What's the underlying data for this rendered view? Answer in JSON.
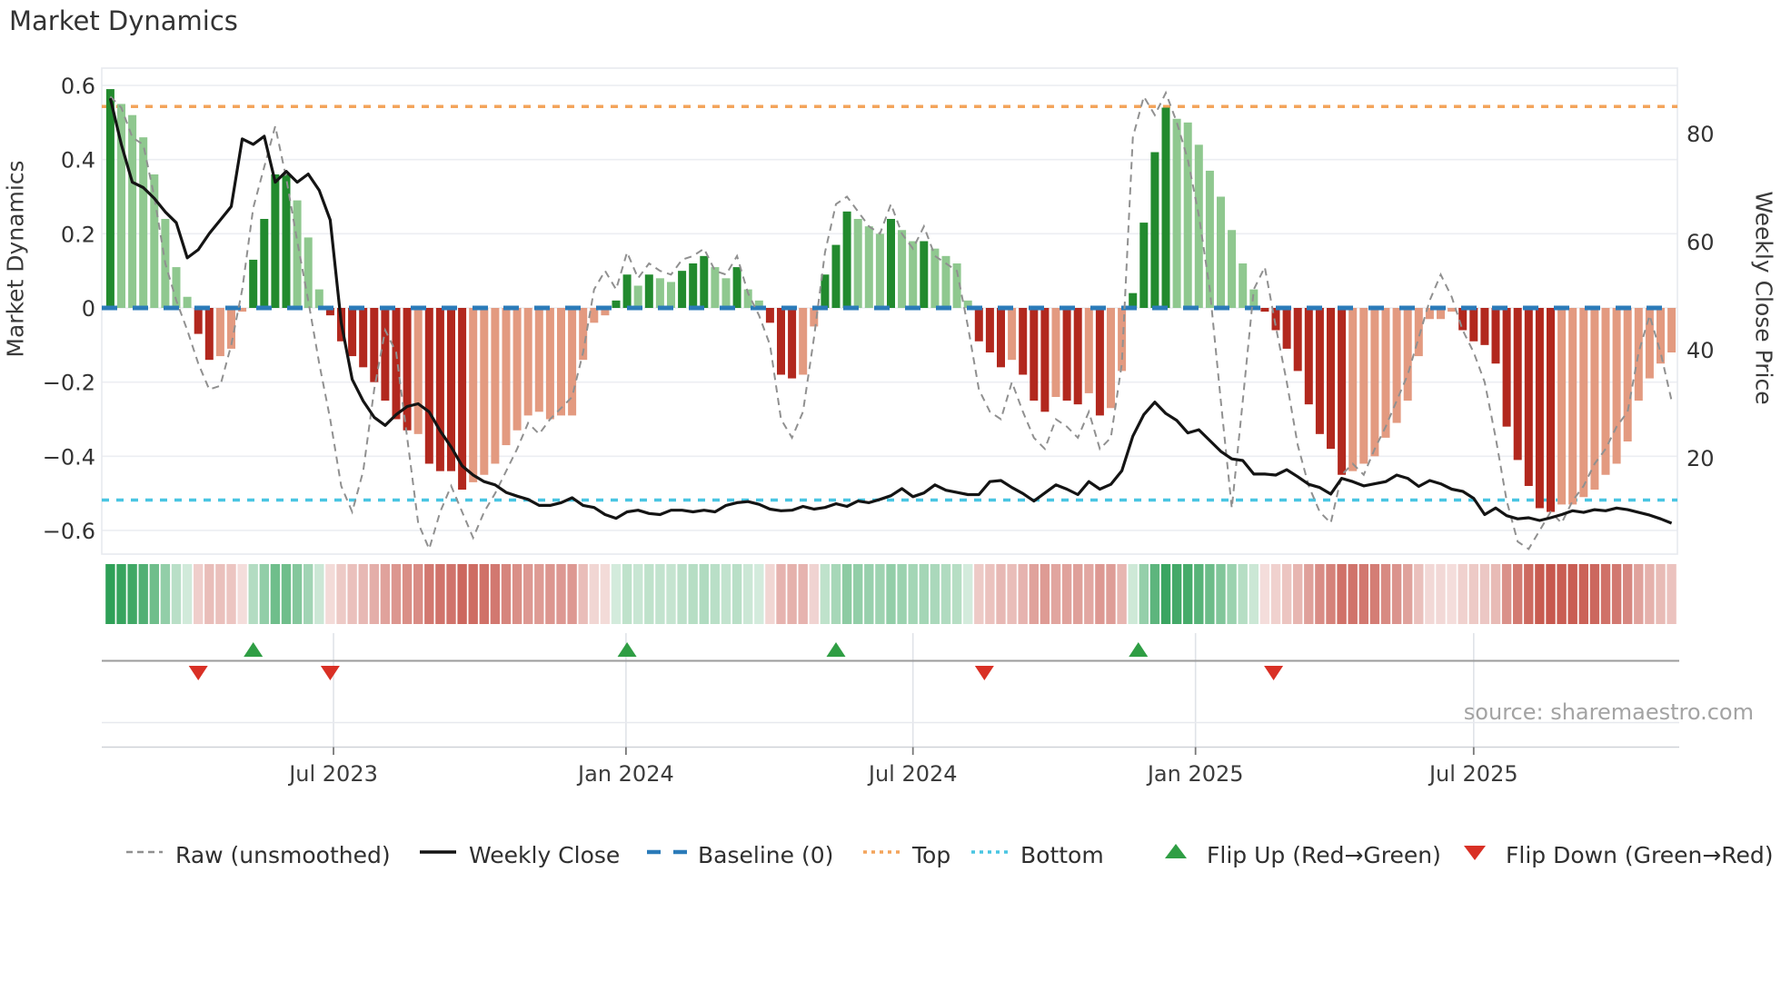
{
  "title": "Market Dynamics",
  "source": "source: sharemaestro.com",
  "axes": {
    "left_label": "Market Dynamics",
    "right_label": "Weekly Close Price",
    "left_ticks": [
      "0.6",
      "0.4",
      "0.2",
      "0",
      "−0.2",
      "−0.4",
      "−0.6"
    ],
    "left_tick_values": [
      0.6,
      0.4,
      0.2,
      0,
      -0.2,
      -0.4,
      -0.6
    ],
    "right_ticks": [
      "80",
      "60",
      "40",
      "20"
    ],
    "right_tick_values": [
      80,
      60,
      40,
      20
    ],
    "x_ticks": [
      {
        "label": "Jul 2023",
        "week": 20.3
      },
      {
        "label": "Jan 2024",
        "week": 46.9
      },
      {
        "label": "Jul 2024",
        "week": 73.0
      },
      {
        "label": "Jan 2025",
        "week": 98.7
      },
      {
        "label": "Jul 2025",
        "week": 124.0
      }
    ]
  },
  "chart_data": {
    "type": "bar",
    "title": "Market Dynamics",
    "x_unit": "weekly",
    "n_points": 143,
    "ylim_left": [
      -0.66,
      0.65
    ],
    "baseline": 0,
    "top_threshold": 0.543,
    "bottom_threshold": -0.518,
    "grid": "horizontal",
    "series": [
      {
        "name": "Market Dynamics (bars)",
        "type": "bar",
        "axis": "left",
        "values": [
          0.59,
          0.55,
          0.52,
          0.46,
          0.36,
          0.24,
          0.11,
          0.03,
          -0.07,
          -0.14,
          -0.13,
          -0.11,
          -0.01,
          0.13,
          0.24,
          0.36,
          0.36,
          0.29,
          0.19,
          0.05,
          -0.02,
          -0.09,
          -0.13,
          -0.16,
          -0.2,
          -0.25,
          -0.3,
          -0.33,
          -0.34,
          -0.42,
          -0.44,
          -0.44,
          -0.49,
          -0.47,
          -0.45,
          -0.42,
          -0.37,
          -0.33,
          -0.29,
          -0.28,
          -0.3,
          -0.29,
          -0.29,
          -0.14,
          -0.04,
          -0.02,
          0.02,
          0.09,
          0.06,
          0.09,
          0.08,
          0.07,
          0.1,
          0.12,
          0.14,
          0.11,
          0.08,
          0.11,
          0.05,
          0.02,
          -0.04,
          -0.18,
          -0.19,
          -0.18,
          -0.05,
          0.09,
          0.17,
          0.26,
          0.24,
          0.22,
          0.2,
          0.24,
          0.21,
          0.18,
          0.18,
          0.16,
          0.14,
          0.12,
          0.02,
          -0.09,
          -0.12,
          -0.16,
          -0.14,
          -0.18,
          -0.25,
          -0.28,
          -0.24,
          -0.25,
          -0.26,
          -0.23,
          -0.29,
          -0.27,
          -0.17,
          0.04,
          0.23,
          0.42,
          0.54,
          0.51,
          0.5,
          0.44,
          0.37,
          0.3,
          0.21,
          0.12,
          0.05,
          -0.01,
          -0.06,
          -0.11,
          -0.17,
          -0.26,
          -0.34,
          -0.38,
          -0.45,
          -0.44,
          -0.42,
          -0.4,
          -0.35,
          -0.31,
          -0.25,
          -0.13,
          -0.03,
          -0.03,
          -0.01,
          -0.06,
          -0.09,
          -0.1,
          -0.15,
          -0.32,
          -0.41,
          -0.48,
          -0.54,
          -0.55,
          -0.53,
          -0.53,
          -0.51,
          -0.49,
          -0.45,
          -0.42,
          -0.36,
          -0.25,
          -0.19,
          -0.15,
          -0.12
        ],
        "shades": "dlllllllddlllddddlllddddddddlddddlllllllllllllddldlldddlldlldddlldddllldlldlllldddldddlddldllddddlllllllldddddddd llllllllllddddddddd lllllllllll"
      },
      {
        "name": "Raw (unsmoothed)",
        "type": "line",
        "axis": "left",
        "values": [
          0.57,
          0.54,
          0.46,
          0.44,
          0.3,
          0.12,
          0.02,
          -0.06,
          -0.15,
          -0.22,
          -0.21,
          -0.1,
          0.05,
          0.27,
          0.38,
          0.49,
          0.35,
          0.18,
          0.02,
          -0.15,
          -0.3,
          -0.48,
          -0.55,
          -0.44,
          -0.22,
          -0.06,
          -0.12,
          -0.35,
          -0.58,
          -0.65,
          -0.55,
          -0.48,
          -0.55,
          -0.62,
          -0.55,
          -0.5,
          -0.44,
          -0.38,
          -0.31,
          -0.34,
          -0.3,
          -0.27,
          -0.24,
          -0.12,
          0.05,
          0.1,
          0.05,
          0.15,
          0.08,
          0.12,
          0.1,
          0.09,
          0.13,
          0.14,
          0.16,
          0.1,
          0.09,
          0.14,
          0.04,
          -0.02,
          -0.1,
          -0.3,
          -0.35,
          -0.28,
          -0.08,
          0.15,
          0.28,
          0.3,
          0.26,
          0.22,
          0.2,
          0.28,
          0.2,
          0.16,
          0.22,
          0.14,
          0.12,
          0.1,
          -0.05,
          -0.22,
          -0.28,
          -0.3,
          -0.2,
          -0.28,
          -0.35,
          -0.38,
          -0.3,
          -0.32,
          -0.35,
          -0.28,
          -0.38,
          -0.35,
          -0.15,
          0.46,
          0.57,
          0.52,
          0.58,
          0.5,
          0.4,
          0.25,
          0.05,
          -0.25,
          -0.54,
          -0.25,
          0.05,
          0.11,
          -0.05,
          -0.2,
          -0.37,
          -0.48,
          -0.55,
          -0.58,
          -0.45,
          -0.42,
          -0.45,
          -0.38,
          -0.32,
          -0.25,
          -0.18,
          -0.08,
          0.02,
          0.09,
          0.03,
          -0.06,
          -0.12,
          -0.2,
          -0.35,
          -0.52,
          -0.63,
          -0.65,
          -0.6,
          -0.55,
          -0.58,
          -0.52,
          -0.48,
          -0.42,
          -0.38,
          -0.32,
          -0.28,
          -0.12,
          -0.02,
          -0.12,
          -0.25
        ]
      },
      {
        "name": "Weekly Close",
        "type": "line",
        "axis": "right",
        "values": [
          86.5,
          78,
          71,
          70,
          68,
          65.5,
          63.5,
          57,
          58.5,
          61.5,
          64,
          66.5,
          79,
          78,
          79.5,
          71,
          73,
          71,
          72.5,
          69.5,
          64,
          45,
          34.5,
          30.5,
          27.5,
          26,
          28,
          29.5,
          30,
          28.5,
          25,
          22,
          18.5,
          16.8,
          15.6,
          15,
          13.6,
          12.9,
          12.3,
          11.2,
          11.2,
          11.7,
          12.6,
          11.2,
          10.8,
          9.5,
          8.8,
          10,
          10.3,
          9.7,
          9.5,
          10.3,
          10.3,
          10,
          10.3,
          10,
          11.2,
          11.7,
          11.9,
          11.4,
          10.5,
          10.2,
          10.3,
          11,
          10.5,
          10.8,
          11.5,
          11,
          12,
          11.7,
          12.3,
          13,
          14.3,
          12.8,
          13.5,
          15,
          14,
          13.6,
          13.2,
          13.2,
          15.6,
          15.8,
          14.5,
          13.4,
          12,
          13.5,
          15,
          14.2,
          13.2,
          15.6,
          14.2,
          15.1,
          17.6,
          24,
          28,
          30.3,
          28.2,
          26.9,
          24.6,
          25.2,
          23.2,
          21.2,
          19.8,
          19.5,
          17,
          17,
          16.8,
          17.8,
          16.5,
          15.1,
          14.5,
          13.3,
          16.2,
          15.6,
          14.8,
          15.2,
          15.6,
          16.8,
          16.2,
          14.7,
          15.8,
          15.2,
          14.2,
          13.8,
          12.5,
          9.5,
          10.7,
          9.3,
          8.7,
          8.9,
          8.4,
          8.9,
          9.5,
          10.2,
          9.9,
          10.4,
          10.2,
          10.7,
          10.4,
          9.9,
          9.4,
          8.7,
          7.9
        ]
      }
    ],
    "flip_up_weeks": [
      13,
      47,
      66,
      93.5
    ],
    "flip_down_weeks": [
      8,
      20,
      79.5,
      105.8
    ]
  },
  "legend": [
    {
      "label": "Raw (unsmoothed)",
      "swatch": "dash",
      "color": "#909090"
    },
    {
      "label": "Weekly Close",
      "swatch": "solid",
      "color": "#141414"
    },
    {
      "label": "Baseline (0)",
      "swatch": "longdash",
      "color": "#2b7bb9"
    },
    {
      "label": "Top",
      "swatch": "dots",
      "color": "#f3a45b"
    },
    {
      "label": "Bottom",
      "swatch": "dots",
      "color": "#49c5e2"
    },
    {
      "label": "Flip Up (Red→Green)",
      "swatch": "tri-up",
      "color": "#2f9e44"
    },
    {
      "label": "Flip Down (Green→Red)",
      "swatch": "tri-down",
      "color": "#d93025"
    }
  ],
  "colors": {
    "bar_dark_green": "#228a2e",
    "bar_light_green": "#8fc88f",
    "bar_dark_red": "#b2281e",
    "bar_salmon": "#e39a80",
    "baseline": "#2b7bb9",
    "top_line": "#f3a45b",
    "bottom_line": "#49c5e2",
    "raw_line": "#909090",
    "close_line": "#141414",
    "heat_green": "#2ea057",
    "heat_red": "#c55146",
    "grid": "#eceef2",
    "marker_up": "#2f9e44",
    "marker_down": "#d93025"
  }
}
